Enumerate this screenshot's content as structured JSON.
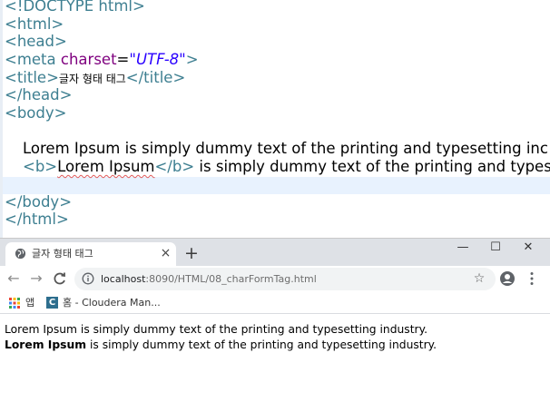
{
  "editor": {
    "lines": {
      "doctype": "<!DOCTYPE html>",
      "html_open": "<html>",
      "head_open": "<head>",
      "meta_tag_open": "<meta",
      "meta_attr": "charset",
      "meta_eq": "=",
      "meta_value": "\"UTF-8\"",
      "meta_close": ">",
      "title_open": "<title>",
      "title_text": "글자 형태 태그",
      "title_close": "</title>",
      "head_close": "</head>",
      "body_open": "<body>",
      "p1_text": "Lorem Ipsum is simply dummy text of the printing and typesetting inc",
      "b_open": "<b>",
      "b_text": "Lorem Ipsum",
      "b_close": "</b>",
      "p2_rest": " is simply dummy text of the printing and types",
      "body_close": "</body>",
      "html_close": "</html>"
    }
  },
  "browser": {
    "tab": {
      "title": "글자 형태 태그",
      "close": "×"
    },
    "new_tab": "+",
    "window_controls": {
      "minimize": "—",
      "maximize": "☐",
      "close": "✕"
    },
    "nav": {
      "back": "←",
      "forward": "→",
      "reload": "C"
    },
    "address": {
      "host": "localhost",
      "path": ":8090/HTML/08_charFormTag.html"
    },
    "bookmark_star": "☆",
    "bookmarks": {
      "apps_label": "앱",
      "favicon_letter": "C",
      "item_label": "홈 - Cloudera Man..."
    },
    "page": {
      "line1": "Lorem Ipsum is simply dummy text of the printing and typesetting industry.",
      "line2_bold": "Lorem Ipsum",
      "line2_rest": " is simply dummy text of the printing and typesetting industry."
    }
  },
  "colors": {
    "tag": "#3e7f91",
    "attr": "#7f007f",
    "string": "#2a00ff",
    "chrome_bar": "#dee1e6",
    "omnibox": "#f1f3f4"
  },
  "icons": [
    "globe-icon",
    "close-icon",
    "plus-icon",
    "minimize-icon",
    "maximize-icon",
    "window-close-icon",
    "back-arrow-icon",
    "forward-arrow-icon",
    "reload-icon",
    "info-icon",
    "star-icon",
    "profile-icon",
    "more-menu-icon",
    "apps-grid-icon",
    "cloudera-favicon"
  ]
}
